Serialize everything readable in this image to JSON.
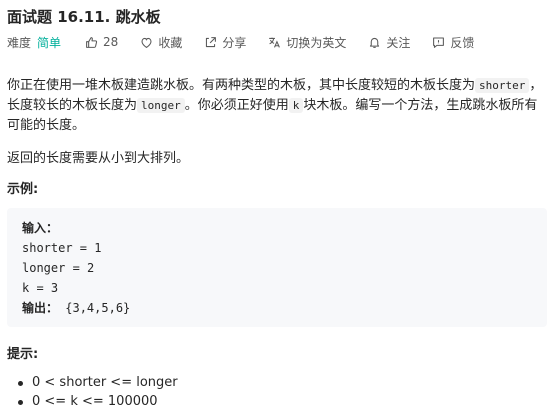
{
  "problem": {
    "title": "面试题 16.11. 跳水板",
    "difficulty_label": "难度",
    "difficulty": "简单",
    "likes": "28",
    "favorite": "收藏",
    "share": "分享",
    "translate": "切换为英文",
    "follow": "关注",
    "feedback": "反馈"
  },
  "description": {
    "p1_a": "你正在使用一堆木板建造跳水板。有两种类型的木板，其中长度较短的木板长度为",
    "code_shorter": "shorter",
    "p1_b": "，长度较长的木板长度为",
    "code_longer": "longer",
    "p1_c": "。你必须正好使用",
    "code_k": "k",
    "p1_d": "块木板。编写一个方法，生成跳水板所有可能的长度。",
    "p2": "返回的长度需要从小到大排列。"
  },
  "example": {
    "heading": "示例:",
    "input_label": "输入：",
    "line1": "shorter = 1",
    "line2": "longer = 2",
    "line3": "k = 3",
    "output_label": "输出：",
    "output_value": " {3,4,5,6}"
  },
  "tips": {
    "heading": "提示:",
    "items": [
      "0 < shorter <= longer",
      "0 <= k <= 100000"
    ]
  },
  "colors": {
    "easy": "#00af9b",
    "text": "#262626",
    "meta": "#595959",
    "code_bg": "#f7f8fa"
  },
  "icons": [
    "thumbs-up-icon",
    "heart-icon",
    "share-icon",
    "translate-icon",
    "bell-icon",
    "feedback-icon"
  ]
}
